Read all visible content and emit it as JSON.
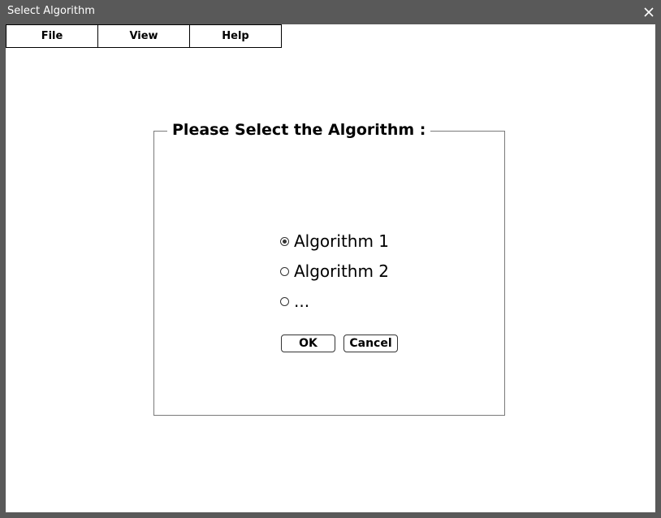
{
  "window": {
    "title": "Select Algorithm",
    "close_icon": "close-icon"
  },
  "menu": {
    "items": [
      {
        "label": "File"
      },
      {
        "label": "View"
      },
      {
        "label": "Help"
      }
    ]
  },
  "group": {
    "legend": "Please Select the Algorithm :",
    "options": [
      {
        "label": "Algorithm 1",
        "checked": true
      },
      {
        "label": "Algorithm 2",
        "checked": false
      },
      {
        "label": "...",
        "checked": false
      }
    ],
    "ok_label": "OK",
    "cancel_label": "Cancel"
  },
  "colors": {
    "frame": "#595959",
    "client": "#ffffff",
    "text": "#000000"
  }
}
